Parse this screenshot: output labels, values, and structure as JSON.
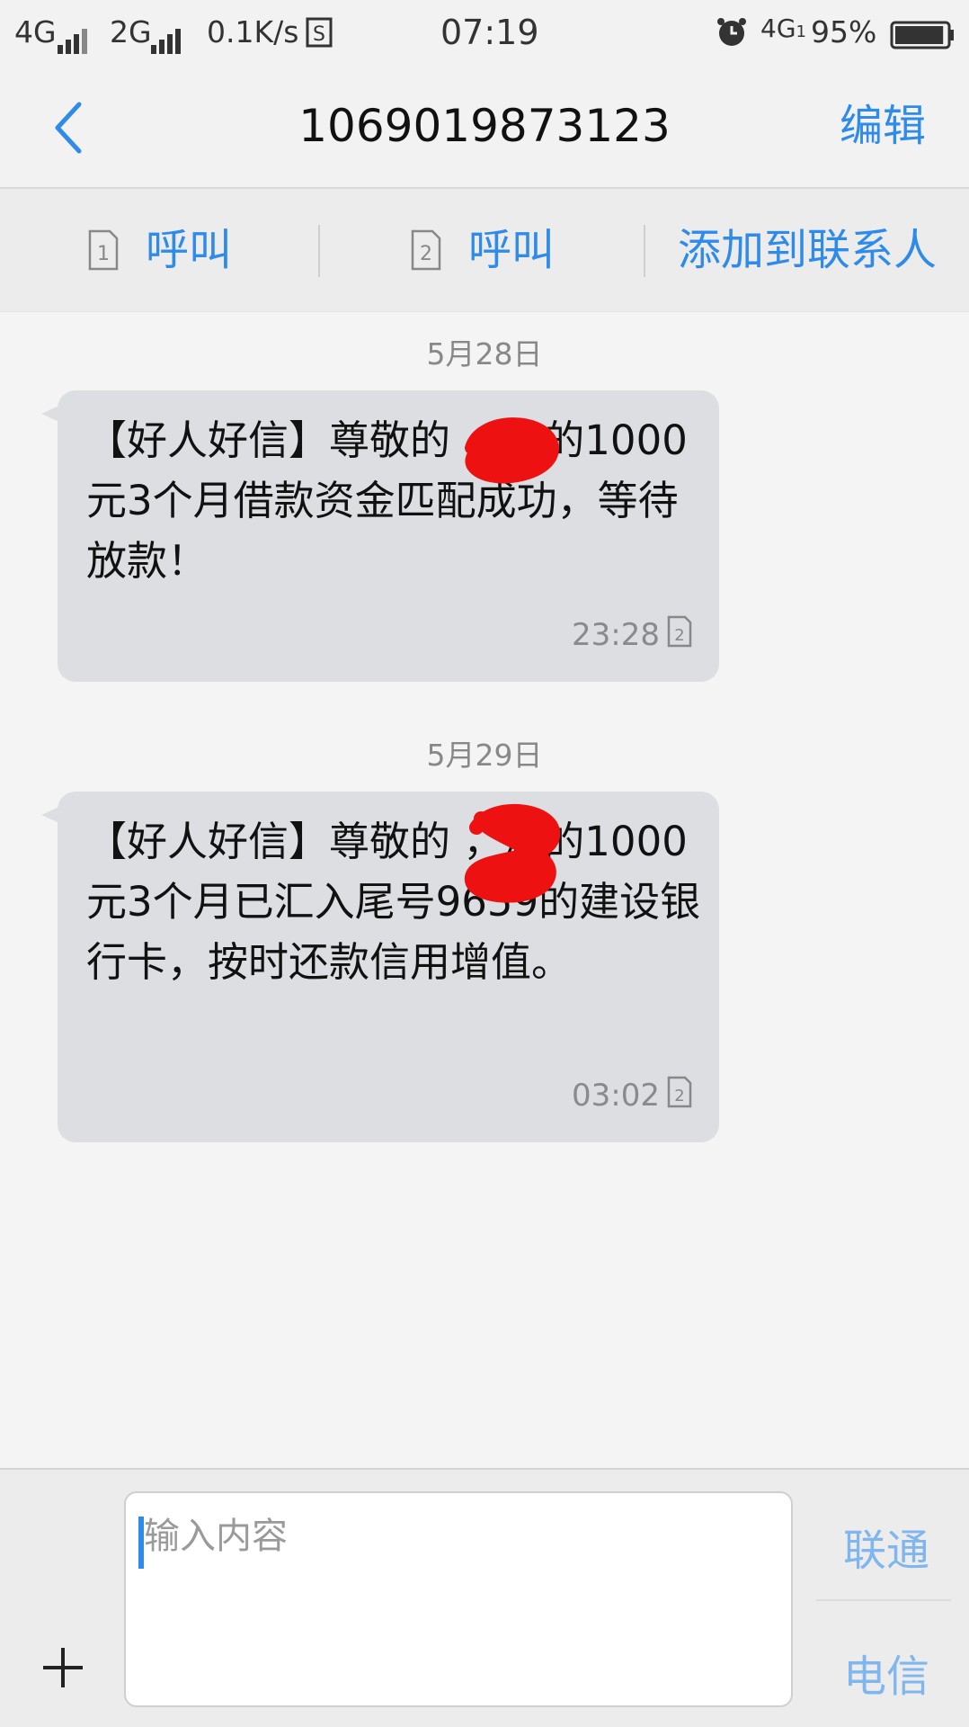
{
  "status_bar": {
    "network1": "4G",
    "network2": "2G",
    "speed": "0.1K/s",
    "time": "07:19",
    "network3": "4G",
    "network3_sub": "1",
    "battery": "95%",
    "battery_level": 0.95
  },
  "header": {
    "title": "1069019873123",
    "edit_label": "编辑"
  },
  "actions": {
    "call1": {
      "sim": "1",
      "label": "呼叫"
    },
    "call2": {
      "sim": "2",
      "label": "呼叫"
    },
    "add_contact": "添加到联系人"
  },
  "messages": [
    {
      "date": "5月28日",
      "text": "【好人好信】尊敬的  ，您的1000元3个月借款资金匹配成功，等待放款！",
      "time": "23:28",
      "sim": "2"
    },
    {
      "date": "5月29日",
      "text": "【好人好信】尊敬的  ，您的1000元3个月已汇入尾号9659的建设银行卡，按时还款信用增值。",
      "time": "03:02",
      "sim": "2"
    }
  ],
  "composer": {
    "placeholder": "输入内容",
    "carrier1": "联通",
    "carrier2": "电信"
  },
  "colors": {
    "accent": "#2e8bea",
    "bubble": "#dcdee2",
    "redaction": "#ee1111"
  }
}
